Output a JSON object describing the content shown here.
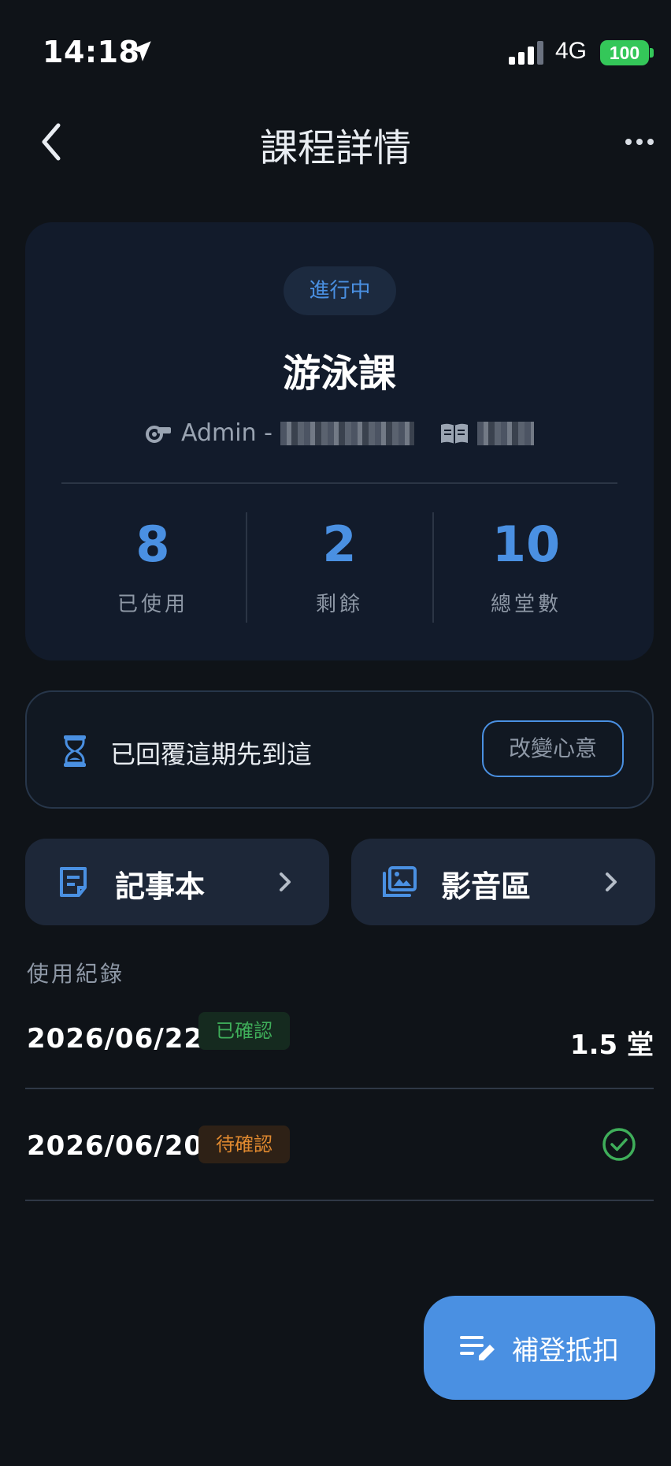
{
  "status_bar": {
    "time": "14:18",
    "network": "4G",
    "battery": "100"
  },
  "nav": {
    "title": "課程詳情"
  },
  "course": {
    "status": "進行中",
    "title": "游泳課",
    "coach_prefix": "Admin -",
    "stats": [
      {
        "value": "8",
        "label": "已使用"
      },
      {
        "value": "2",
        "label": "剩餘"
      },
      {
        "value": "10",
        "label": "總堂數"
      }
    ]
  },
  "renew": {
    "text": "已回覆這期先到這",
    "button": "改變心意"
  },
  "quick_links": [
    {
      "label": "記事本",
      "icon": "notebook-icon"
    },
    {
      "label": "影音區",
      "icon": "gallery-icon"
    }
  ],
  "history": {
    "title": "使用紀錄",
    "records": [
      {
        "date": "2026/06/22",
        "badge": "已確認",
        "amount": "1.5 堂"
      },
      {
        "date": "2026/06/20",
        "badge": "待確認",
        "amount": ""
      }
    ]
  },
  "fab": {
    "label": "補登抵扣"
  },
  "colors": {
    "accent": "#4a90e2",
    "success": "#3fae5a",
    "warning": "#e0892f",
    "background": "#0f1318"
  }
}
